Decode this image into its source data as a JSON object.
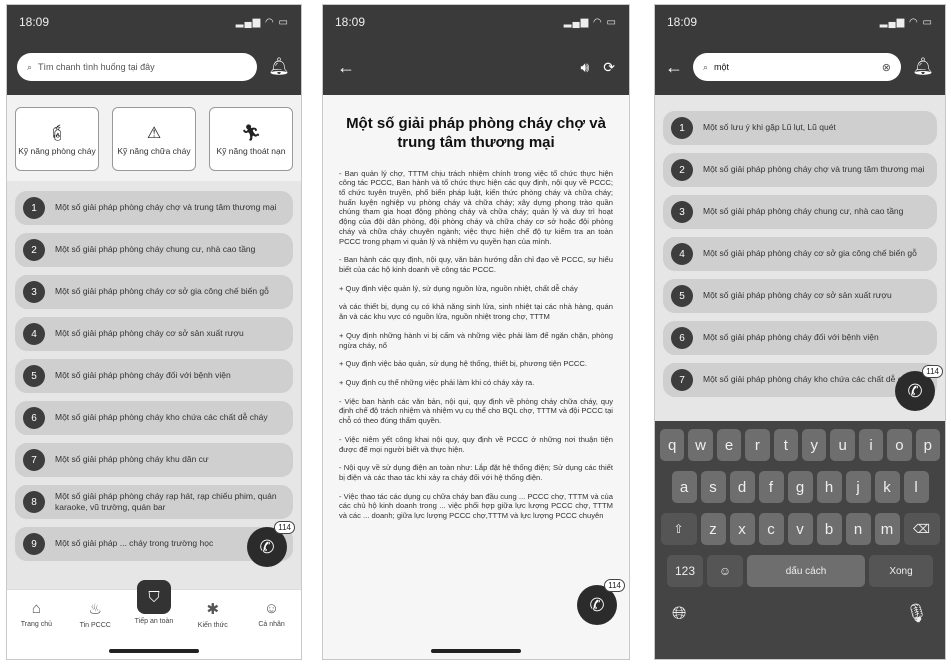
{
  "screen1": {
    "time": "18:09",
    "search_placeholder": "Tìm chanh tình huống tại đây",
    "skills": [
      "Kỹ năng phòng cháy",
      "Kỹ năng chữa cháy",
      "Kỹ năng thoát nạn"
    ],
    "items": [
      {
        "num": "1",
        "text": "Một số giải pháp phòng cháy chợ và trung tâm thương mại"
      },
      {
        "num": "2",
        "text": "Một số giải pháp phòng cháy chung cư, nhà cao tầng"
      },
      {
        "num": "3",
        "text": "Một số giải pháp phòng cháy cơ sở gia công chế biến gỗ"
      },
      {
        "num": "4",
        "text": "Một số giải pháp phòng cháy cơ sở sản xuất rượu"
      },
      {
        "num": "5",
        "text": "Một số giải pháp phòng cháy đối với bệnh viện"
      },
      {
        "num": "6",
        "text": "Một số giải pháp phòng cháy kho chứa các chất dễ cháy"
      },
      {
        "num": "7",
        "text": "Một số giải pháp phòng cháy khu dân cư"
      },
      {
        "num": "8",
        "text": "Một số giải pháp phòng cháy rạp hát, rạp chiếu phim, quán karaoke, vũ trường, quán bar"
      },
      {
        "num": "9",
        "text": "Một số giải pháp ... cháy trong trường học"
      }
    ],
    "fab_badge": "114",
    "nav": [
      {
        "label": "Trang chủ",
        "icon": "home-icon"
      },
      {
        "label": "Tin PCCC",
        "icon": "fire-icon"
      },
      {
        "label": "Tiếp an toàn",
        "icon": "shield-icon"
      },
      {
        "label": "Kiến thức",
        "icon": "knowledge-icon"
      },
      {
        "label": "Cá nhân",
        "icon": "smile-icon"
      }
    ]
  },
  "screen2": {
    "time": "18:09",
    "title": "Một số giải pháp phòng cháy chợ và trung tâm thương mại",
    "paragraphs": [
      "- Ban quản lý chợ, TTTM chịu trách nhiệm chính trong việc tổ chức thực hiện công tác PCCC, Ban hành và tổ chức thực hiện các quy định, nội quy về PCCC; tổ chức tuyên truyền, phổ biến pháp luật, kiến thức phòng cháy và chữa cháy; huấn luyện nghiệp vụ phòng cháy và chữa cháy; xây dựng phong trào quần chúng tham gia hoạt động phòng cháy và chữa cháy; quản lý và duy trì hoạt động của đội dân phòng, đội phòng cháy và chữa cháy cơ sở hoặc đội phòng cháy và chữa cháy chuyên ngành; việc thực hiện chế độ tự kiểm tra an toàn PCCC trong phạm vi quản lý và nhiệm vụ quyền hạn của mình.",
      "- Ban hành các quy định, nội quy, văn bản hướng dẫn chỉ đạo về PCCC, sự hiểu biết của các hộ kinh doanh về công tác PCCC.",
      "+ Quy định việc quản lý, sử dụng nguồn lửa, nguồn nhiệt, chất dễ cháy",
      "và các thiết bị, dụng cụ có khả năng sinh lửa, sinh nhiệt tại các nhà hàng, quán ăn và các khu vực có nguồn lửa, nguồn nhiệt trong chợ, TTTM",
      "+ Quy định những hành vi bị cấm và những việc phải làm để ngăn chặn, phòng ngừa cháy, nổ",
      "+ Quy định việc bảo quản, sử dụng hệ thống, thiết bị, phương tiện PCCC.",
      "+ Quy định cụ thể những việc phải làm khi có cháy xảy ra.",
      "- Việc ban hành các văn bản, nội qui, quy định về phòng cháy chữa cháy, quy định chế độ trách nhiệm và nhiệm vụ cụ thể cho BQL chợ, TTTM và đội PCCC tại chỗ có theo đúng thẩm quyền.",
      "- Việc niêm yết công khai nội quy, quy định về PCCC ở những nơi thuận tiện được để mọi người biết và thực hiện.",
      "- Nội quy về sử dụng điện an toàn như: Lắp đặt hệ thống điện; Sử dụng các thiết bị điện và các thao tác khi xảy ra cháy đối với hệ thống điện.",
      "- Việc thao tác các dụng cụ chữa cháy ban đầu cung ... PCCC chợ, TTTM và của các chủ hộ kinh doanh trong ... việc phối hợp giữa lực lượng PCCC chợ, TTTM và các ... doanh; giữa lực lượng PCCC chợ,TTTM và lực lượng PCCC chuyên"
    ],
    "fab_badge": "114"
  },
  "screen3": {
    "time": "18:09",
    "search_value": "một",
    "items": [
      {
        "num": "1",
        "text": "Một số lưu ý khi gặp Lũ lụt, Lũ quét"
      },
      {
        "num": "2",
        "text": "Một số giải pháp phòng cháy chợ và trung tâm thương mại"
      },
      {
        "num": "3",
        "text": "Một số giải pháp phòng cháy chung cư, nhà cao tầng"
      },
      {
        "num": "4",
        "text": "Một số giải pháp phòng cháy cơ sở gia công chế biến gỗ"
      },
      {
        "num": "5",
        "text": "Một số giải pháp phòng cháy cơ sở sản xuất rượu"
      },
      {
        "num": "6",
        "text": "Một số giải pháp phòng cháy đối với bệnh viện"
      },
      {
        "num": "7",
        "text": "Một số giải pháp phòng cháy kho chứa các chất dễ cháy"
      }
    ],
    "fab_badge": "114",
    "keyboard": {
      "row1": [
        "q",
        "w",
        "e",
        "r",
        "t",
        "y",
        "u",
        "i",
        "o",
        "p"
      ],
      "row2": [
        "a",
        "s",
        "d",
        "f",
        "g",
        "h",
        "j",
        "k",
        "l"
      ],
      "row3": [
        "z",
        "x",
        "c",
        "v",
        "b",
        "n",
        "m"
      ],
      "num_key": "123",
      "space": "dấu cách",
      "done": "Xong"
    }
  }
}
